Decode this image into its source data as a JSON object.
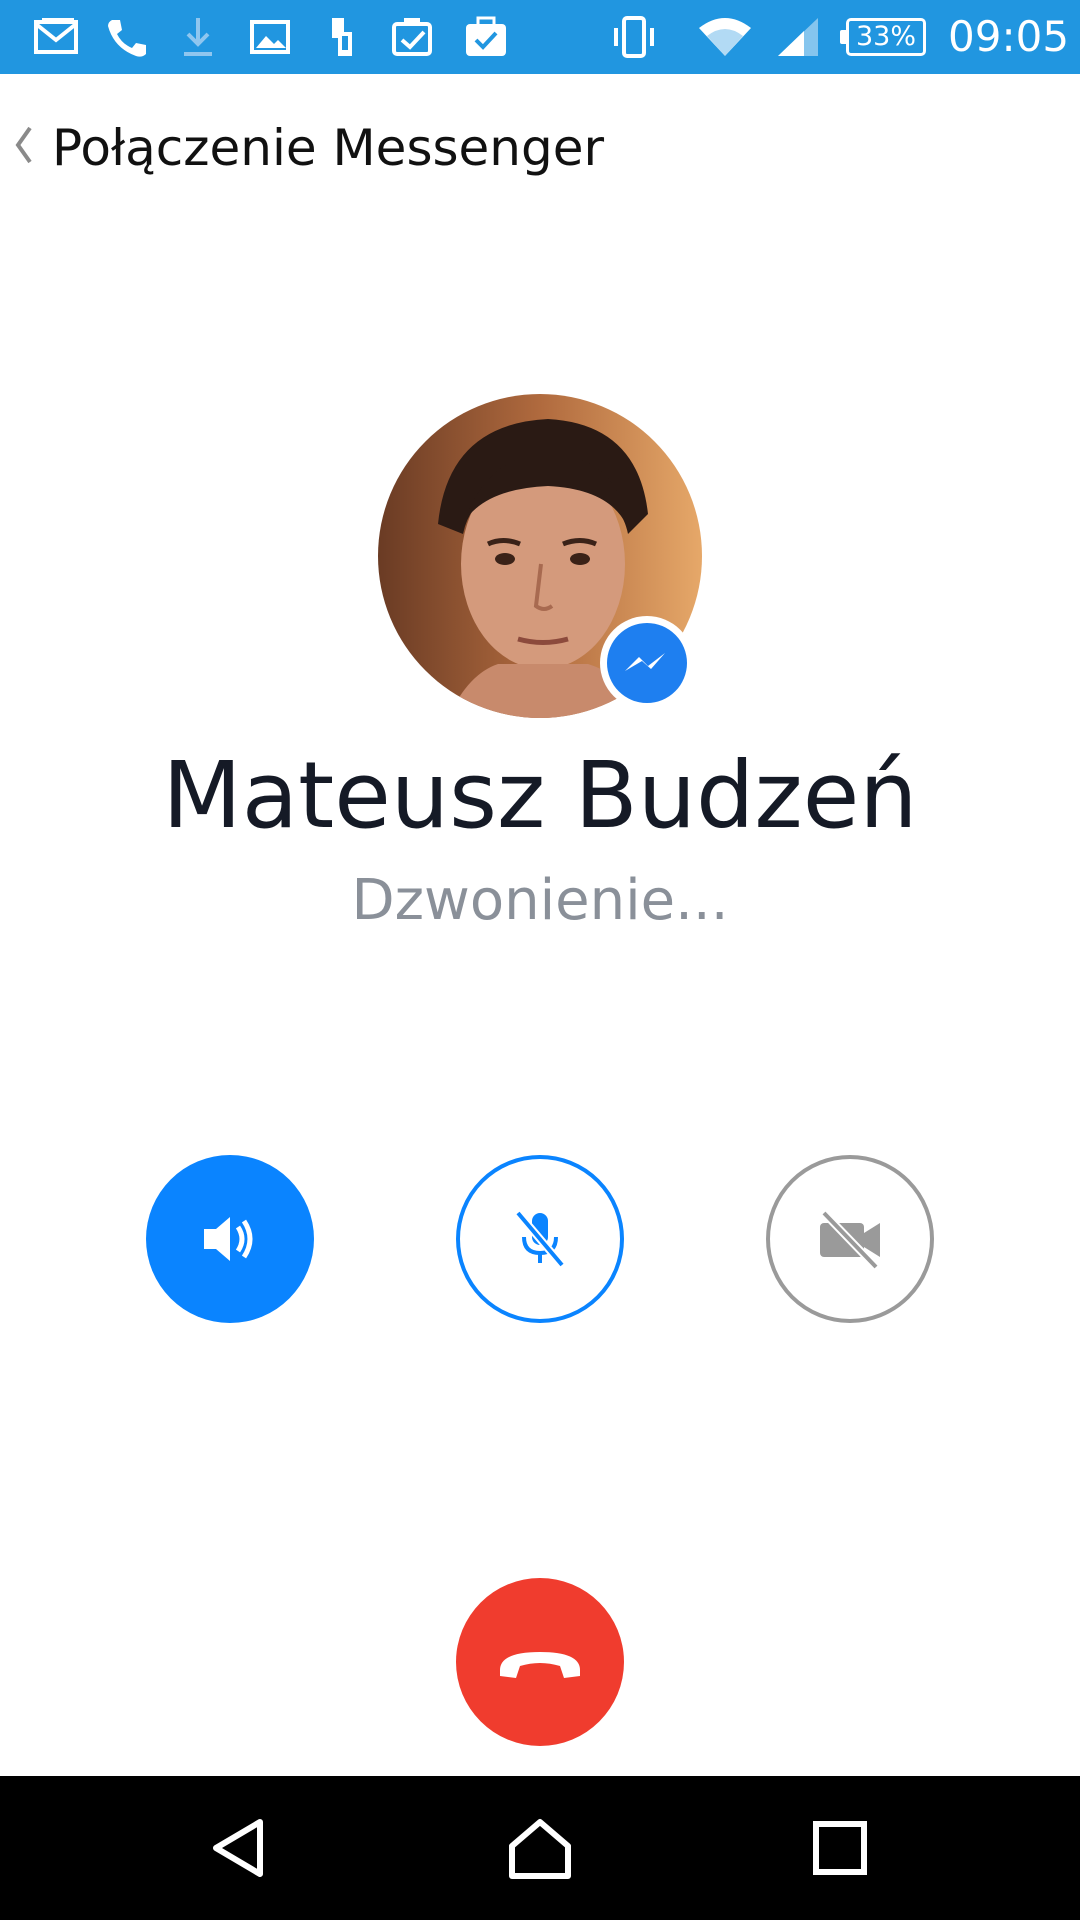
{
  "status_bar": {
    "battery": "33%",
    "time": "09:05",
    "icons": [
      "gmail-icon",
      "phone-icon",
      "download-icon",
      "gallery-icon",
      "device-icon",
      "clipboard-check-icon",
      "briefcase-check-icon",
      "vibrate-icon",
      "wifi-icon",
      "signal-icon"
    ],
    "background_color": "#2196e0"
  },
  "header": {
    "title": "Połączenie Messenger",
    "back_icon": "chevron-left-icon"
  },
  "call": {
    "caller_name": "Mateusz Budzeń",
    "status": "Dzwonienie...",
    "badge_icon": "messenger-icon"
  },
  "controls": {
    "speaker": {
      "icon": "speaker-icon",
      "active": true
    },
    "mute": {
      "icon": "mic-off-icon",
      "active": false
    },
    "video": {
      "icon": "video-off-icon",
      "active": false
    },
    "end_call": {
      "icon": "end-call-icon",
      "color": "#f03c2e"
    },
    "accent_color": "#0a84ff"
  },
  "nav_bar": {
    "icons": [
      "back-triangle-icon",
      "home-icon",
      "recents-icon"
    ]
  }
}
